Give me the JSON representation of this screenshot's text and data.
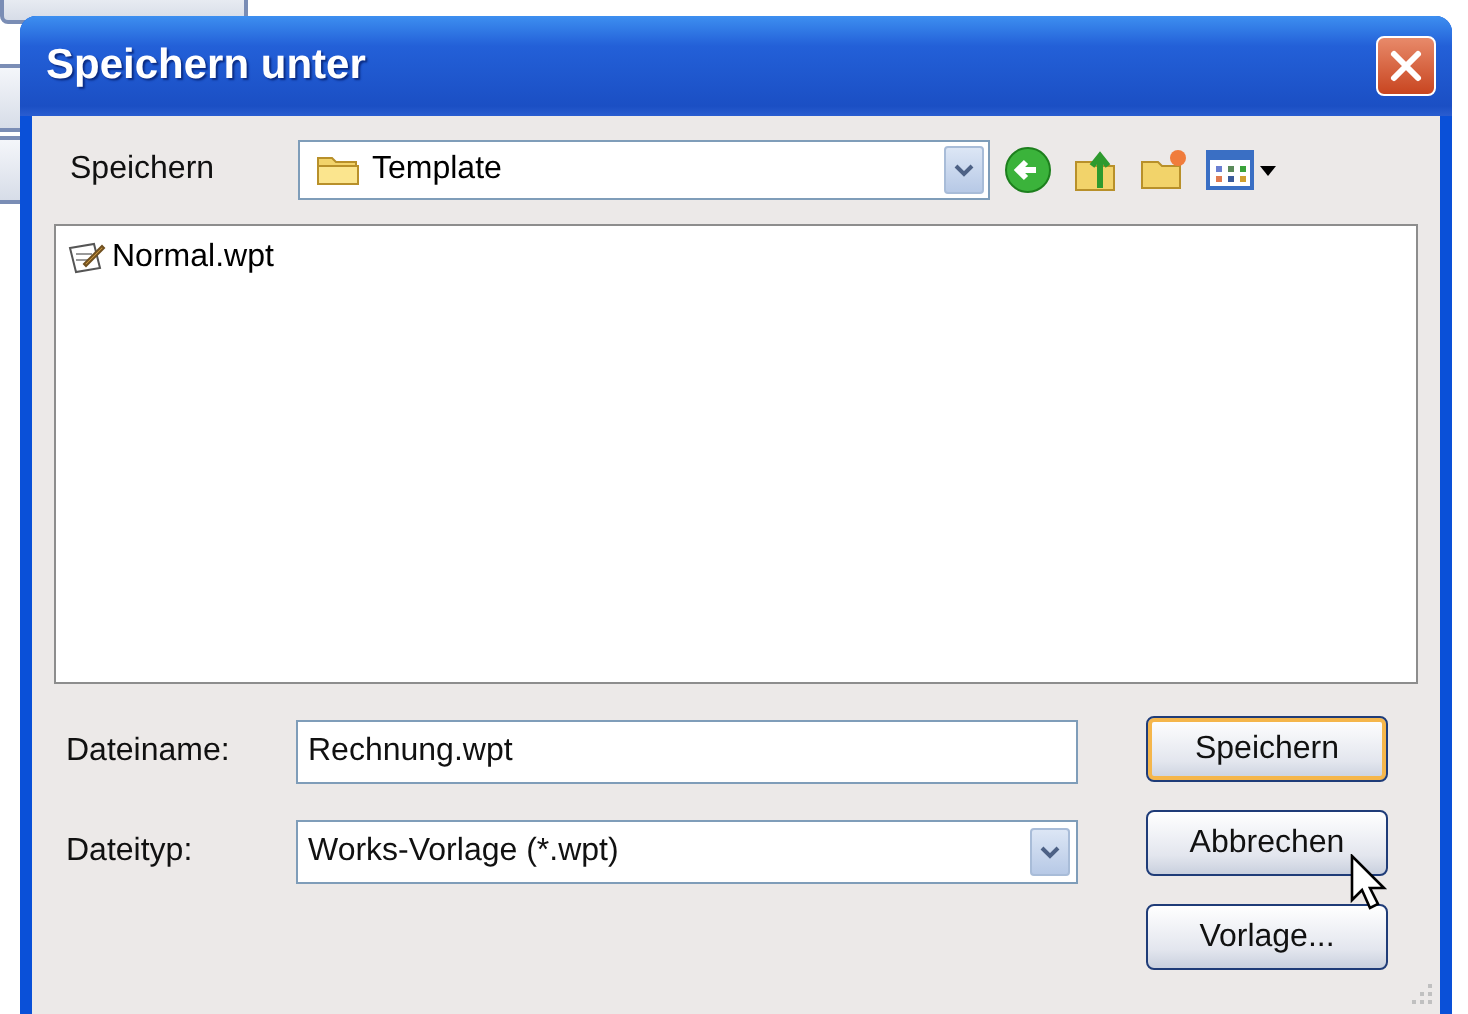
{
  "window": {
    "title": "Speichern unter"
  },
  "location": {
    "label": "Speichern",
    "value": "Template"
  },
  "files": [
    {
      "name": "Normal.wpt",
      "selected": false
    }
  ],
  "filename": {
    "label": "Dateiname:",
    "value": "Rechnung.wpt"
  },
  "filetype": {
    "label": "Dateityp:",
    "value": "Works-Vorlage (*.wpt)"
  },
  "buttons": [
    {
      "label": "Speichern",
      "default": true
    },
    {
      "label": "Abbrechen",
      "default": false
    },
    {
      "label": "Vorlage...",
      "default": false
    }
  ]
}
